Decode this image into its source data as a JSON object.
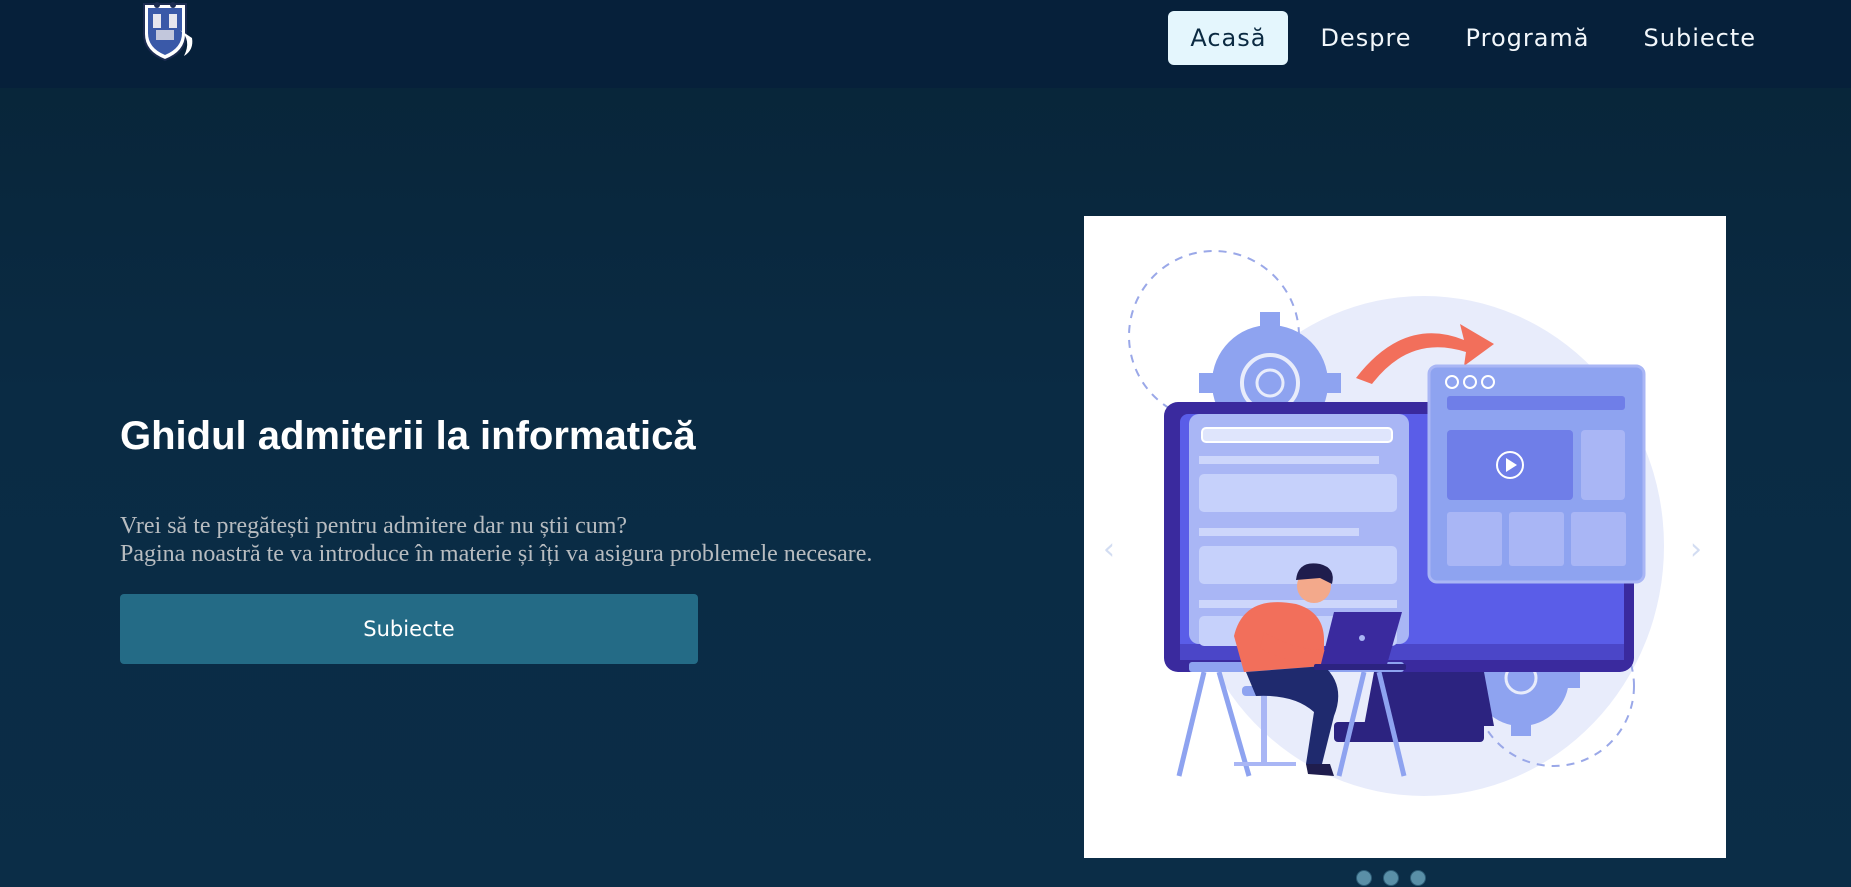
{
  "nav": {
    "logo_alt": "",
    "items": [
      {
        "label": "Acasă",
        "active": true
      },
      {
        "label": "Despre",
        "active": false
      },
      {
        "label": "Programă",
        "active": false
      },
      {
        "label": "Subiecte",
        "active": false
      }
    ]
  },
  "hero": {
    "title": "Ghidul admiterii la informatică",
    "text_line1": "Vrei să te pregătești pentru admitere dar nu știi cum?",
    "text_line2": "Pagina noastră te va introduce în materie și îți va asigura problemele necesare.",
    "button_label": "Subiecte"
  },
  "carousel": {
    "prev_glyph": "‹",
    "next_glyph": "›",
    "slide_count": 3,
    "active_slide": 1
  },
  "colors": {
    "background": "#0a2b44",
    "navbar": "#06203a",
    "nav_active_bg": "#e4f6fd",
    "button": "#246b86",
    "illustration_accent": "#5a5de8",
    "illustration_orange": "#f26f5b"
  }
}
